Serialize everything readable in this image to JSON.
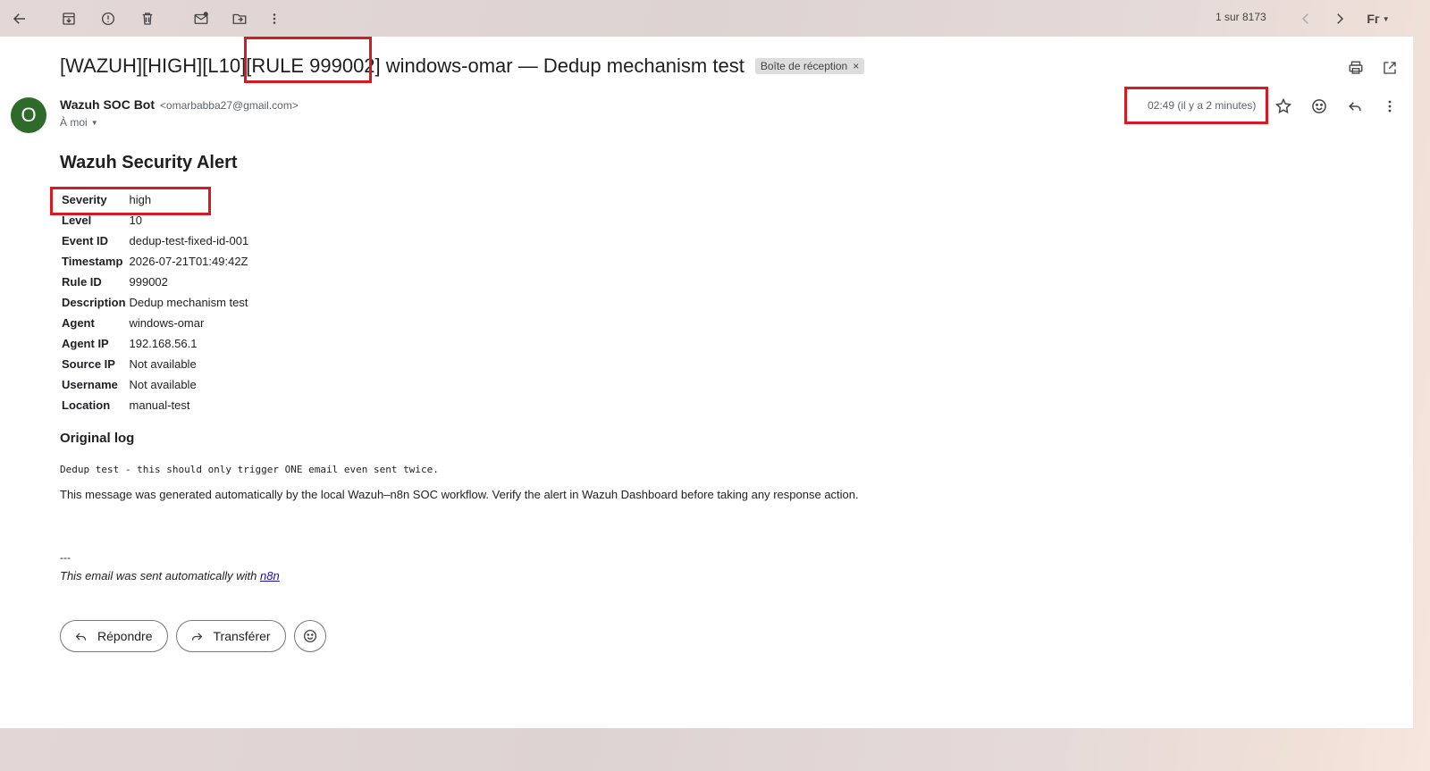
{
  "toolbar": {
    "pager": "1 sur 8173",
    "input_tool": "Fг"
  },
  "email": {
    "subject_prefix": "[WAZUH][HIGH][L10]",
    "subject_rule": "[RULE 999002]",
    "subject_suffix": "windows-omar — Dedup mechanism test",
    "label": "Boîte de réception",
    "label_close": "×",
    "sender_initial": "O",
    "sender_name": "Wazuh SOC Bot",
    "sender_email": "<omarbabba27@gmail.com>",
    "recipient": "À moi",
    "time": "02:49 (il y a 2 minutes)"
  },
  "alert": {
    "title": "Wazuh Security Alert",
    "fields": [
      {
        "key": "Severity",
        "value": "high"
      },
      {
        "key": "Level",
        "value": "10"
      },
      {
        "key": "Event ID",
        "value": "dedup-test-fixed-id-001"
      },
      {
        "key": "Timestamp",
        "value": "2026-07-21T01:49:42Z"
      },
      {
        "key": "Rule ID",
        "value": "999002"
      },
      {
        "key": "Description",
        "value": "Dedup mechanism test"
      },
      {
        "key": "Agent",
        "value": "windows-omar"
      },
      {
        "key": "Agent IP",
        "value": "192.168.56.1"
      },
      {
        "key": "Source IP",
        "value": "Not available"
      },
      {
        "key": "Username",
        "value": "Not available"
      },
      {
        "key": "Location",
        "value": "manual-test"
      }
    ],
    "log_title": "Original log",
    "log_text": "Dedup test - this should only trigger ONE email even sent twice.",
    "notice": "This message was generated automatically by the local Wazuh–n8n SOC workflow. Verify the alert in Wazuh Dashboard before taking any response action.",
    "separator": "---",
    "footer_text": "This email was sent automatically with ",
    "footer_link": "n8n"
  },
  "actions": {
    "reply": "Répondre",
    "forward": "Transférer"
  },
  "colors": {
    "highlight": "#d71a21",
    "avatar": "#2e6b2a",
    "link": "#1a0dab"
  }
}
